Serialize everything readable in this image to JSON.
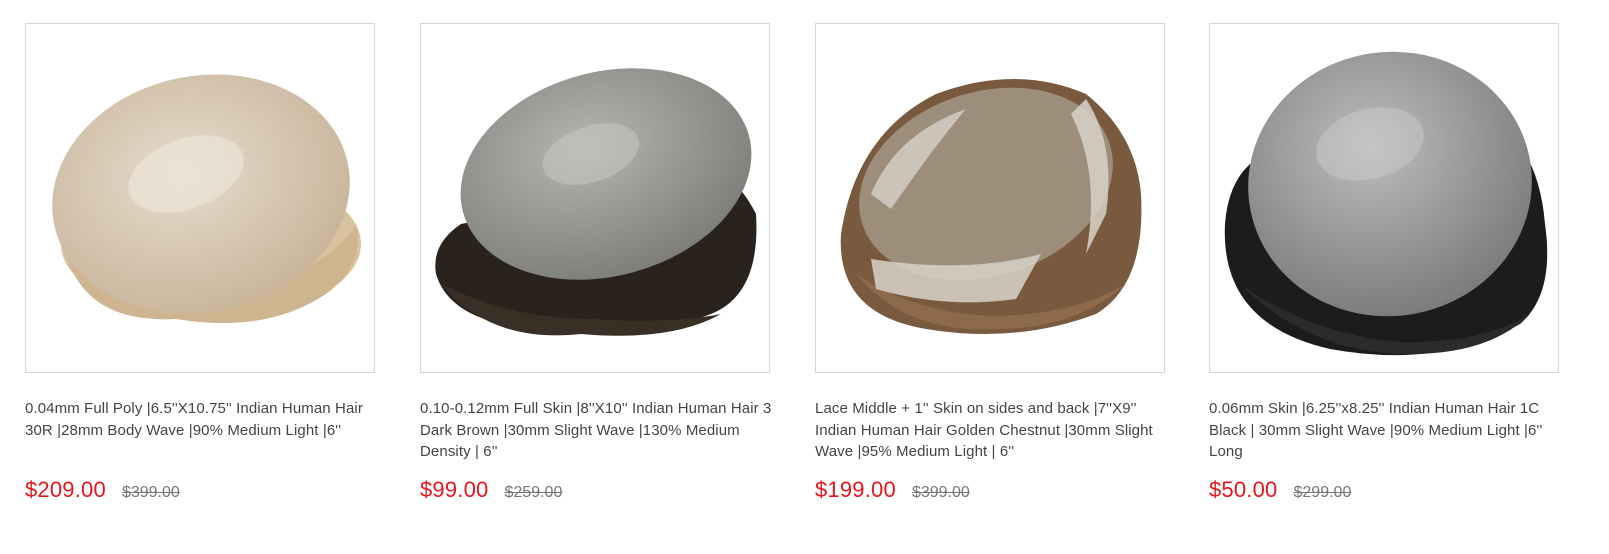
{
  "products": [
    {
      "image": "hair-system-icon",
      "title": "0.04mm Full Poly |6.5''X10.75'' Indian Human Hair 30R |28mm Body Wave |90% Medium Light |6''",
      "price": "$209.00",
      "old_price": "$399.00"
    },
    {
      "image": "hair-system-icon",
      "title": "0.10-0.12mm Full Skin |8''X10'' Indian Human Hair 3 Dark Brown |30mm Slight Wave |130% Medium Density | 6''",
      "price": "$99.00",
      "old_price": "$259.00"
    },
    {
      "image": "hair-system-icon",
      "title": "Lace Middle + 1'' Skin on sides and back |7''X9'' Indian Human Hair Golden Chestnut |30mm Slight Wave |95% Medium Light | 6''",
      "price": "$199.00",
      "old_price": "$399.00"
    },
    {
      "image": "hair-system-icon",
      "title": "0.06mm Skin |6.25''x8.25'' Indian Human Hair 1C Black | 30mm Slight Wave |90% Medium Light |6'' Long",
      "price": "$50.00",
      "old_price": "$299.00"
    }
  ],
  "colors": {
    "price": "#e8141b",
    "old_price": "#777777",
    "title": "#444444",
    "border": "#d6d6d6"
  }
}
